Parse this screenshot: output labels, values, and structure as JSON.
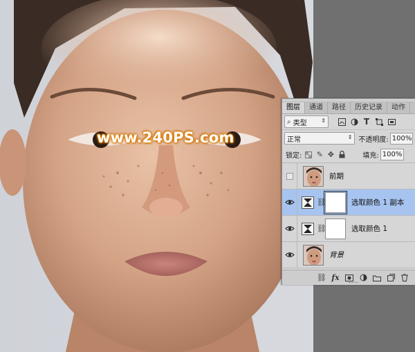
{
  "canvas": {
    "watermark": "www.240PS.com"
  },
  "layers_panel": {
    "tabs": [
      {
        "label": "图层",
        "active": true
      },
      {
        "label": "通道",
        "active": false
      },
      {
        "label": "路径",
        "active": false
      },
      {
        "label": "历史记录",
        "active": false
      },
      {
        "label": "动作",
        "active": false
      }
    ],
    "filter": {
      "kind_label": "类型",
      "icons": [
        "image-filter-icon",
        "adjustment-filter-icon",
        "text-filter-icon",
        "shape-filter-icon",
        "smart-object-filter-icon"
      ]
    },
    "blend_mode": "正常",
    "opacity_label": "不透明度:",
    "opacity_value": "100%",
    "lock_label": "锁定:",
    "fill_label": "填充:",
    "fill_value": "100%",
    "layers": [
      {
        "name": "前期",
        "visible": false,
        "type": "pixel",
        "selected": false
      },
      {
        "name": "选取颜色 1 副本",
        "visible": true,
        "type": "adjustment",
        "selected": true
      },
      {
        "name": "选取颜色 1",
        "visible": true,
        "type": "adjustment",
        "selected": false
      },
      {
        "name": "背景",
        "visible": true,
        "type": "background",
        "selected": false
      }
    ],
    "footer_icons": [
      "link-icon",
      "fx-icon",
      "add-mask-icon",
      "new-adjustment-icon",
      "new-group-icon",
      "new-layer-icon",
      "delete-icon"
    ],
    "colors": {
      "panel_bg": "#d6d6d6",
      "selected_row": "#a6c4ef",
      "watermark_glow": "#e58a00"
    }
  }
}
